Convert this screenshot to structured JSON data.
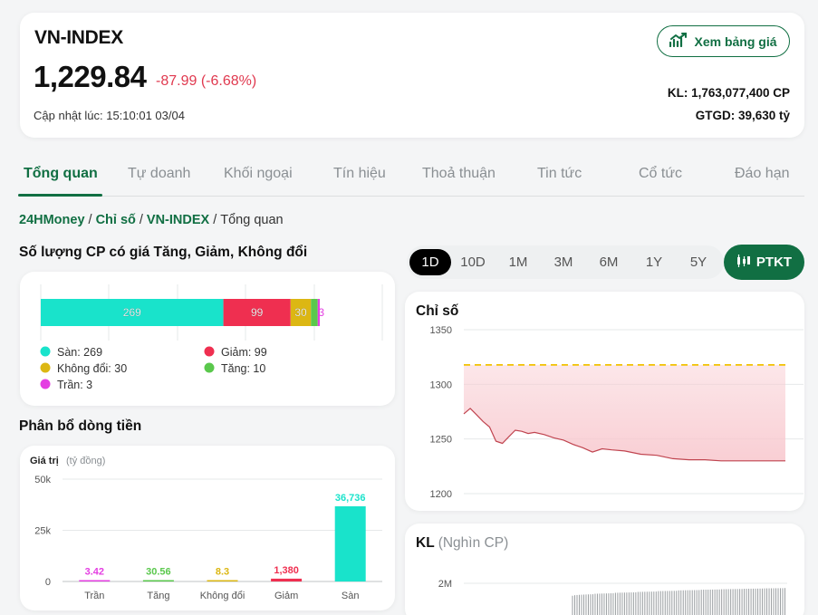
{
  "header": {
    "index_name": "VN-INDEX",
    "value": "1,229.84",
    "change": "-87.99 (-6.68%)",
    "updated": "Cập nhật lúc: 15:10:01 03/04",
    "xem_button": "Xem bảng giá",
    "kl": "KL: 1,763,077,400 CP",
    "gtgd": "GTGD: 39,630 tỷ",
    "negative_color": "#e0394f",
    "brand_color": "#116f43"
  },
  "tabs": [
    {
      "label": "Tổng quan",
      "active": true
    },
    {
      "label": "Tự doanh"
    },
    {
      "label": "Khối ngoại"
    },
    {
      "label": "Tín hiệu"
    },
    {
      "label": "Thoả thuận"
    },
    {
      "label": "Tin tức"
    },
    {
      "label": "Cổ tức"
    },
    {
      "label": "Đáo hạn"
    }
  ],
  "breadcrumb": [
    "24HMoney",
    "Chỉ số",
    "VN-INDEX",
    "Tổng quan"
  ],
  "stock_section": {
    "title": "Số lượng CP có giá Tăng, Giảm, Không đổi",
    "legend": [
      {
        "label": "Sàn: 269",
        "color": "#19e3cb"
      },
      {
        "label": "Giảm: 99",
        "color": "#ef2f50"
      },
      {
        "label": "Không đổi: 30",
        "color": "#dcb713"
      },
      {
        "label": "Tăng: 10",
        "color": "#5ac84c"
      },
      {
        "label": "Trần: 3",
        "color": "#e43ee2"
      }
    ]
  },
  "flow_section": {
    "title": "Phân bổ dòng tiền",
    "axis_title": "Giá trị",
    "axis_unit": "(tỷ đồng)"
  },
  "range": {
    "options": [
      "1D",
      "10D",
      "1M",
      "3M",
      "6M",
      "1Y",
      "5Y"
    ],
    "active": "1D",
    "ptkt_label": "PTKT"
  },
  "index_chart": {
    "title": "Chỉ số"
  },
  "kl_chart": {
    "title": "KL",
    "unit": "(Nghìn CP)"
  },
  "chart_data": [
    {
      "type": "bar",
      "orientation": "horizontal-stacked",
      "series": [
        {
          "name": "Sàn",
          "value": 269,
          "color": "#19e3cb"
        },
        {
          "name": "Giảm",
          "value": 99,
          "color": "#ef2f50"
        },
        {
          "name": "Không đổi",
          "value": 30,
          "color": "#dcb713"
        },
        {
          "name": "Tăng",
          "value": 10,
          "color": "#5ac84c"
        },
        {
          "name": "Trần",
          "value": 3,
          "color": "#e43ee2"
        }
      ],
      "data_labels": [
        "269",
        "99",
        "30",
        "3"
      ]
    },
    {
      "type": "bar",
      "categories": [
        "Trần",
        "Tăng",
        "Không đổi",
        "Giảm",
        "Sàn"
      ],
      "values": [
        3.42,
        30.56,
        8.3,
        1380,
        36736
      ],
      "value_labels": [
        "3.42",
        "30.56",
        "8.3",
        "1,380",
        "36,736"
      ],
      "colors": [
        "#e43ee2",
        "#5ac84c",
        "#dcb713",
        "#ef2f50",
        "#19e3cb"
      ],
      "ylabel": "Giá trị",
      "ylim": [
        0,
        50000
      ],
      "yticks": [
        "0",
        "25k",
        "50k"
      ],
      "grid": true
    },
    {
      "type": "area",
      "ylim": [
        1190,
        1360
      ],
      "yticks": [
        1200,
        1250,
        1300,
        1350
      ],
      "reference_line": 1317.83,
      "reference_color": "#f2c200",
      "fill_color": "#f8c9cf",
      "line_color": "#c0444f",
      "x": [
        0,
        0.02,
        0.04,
        0.06,
        0.08,
        0.1,
        0.12,
        0.14,
        0.16,
        0.18,
        0.2,
        0.22,
        0.25,
        0.28,
        0.31,
        0.34,
        0.37,
        0.4,
        0.43,
        0.46,
        0.5,
        0.55,
        0.6,
        0.65,
        0.7,
        0.75,
        0.8,
        0.85,
        0.9,
        0.95,
        1.0
      ],
      "values": [
        1273,
        1278,
        1272,
        1266,
        1261,
        1248,
        1246,
        1252,
        1258,
        1257,
        1255,
        1256,
        1254,
        1251,
        1249,
        1245,
        1242,
        1238,
        1241,
        1240,
        1239,
        1236,
        1235,
        1232,
        1231,
        1231,
        1230,
        1230,
        1230,
        1230,
        1230
      ]
    },
    {
      "type": "bar",
      "title": "KL",
      "ylim": [
        0,
        2500000
      ],
      "yticks": [
        "2M"
      ],
      "values_desc": "cumulative volume rising",
      "values": [
        1620000,
        1640000,
        1660000,
        1680000,
        1700000,
        1720000,
        1735000,
        1745000,
        1752000,
        1758000,
        1763077
      ]
    }
  ]
}
